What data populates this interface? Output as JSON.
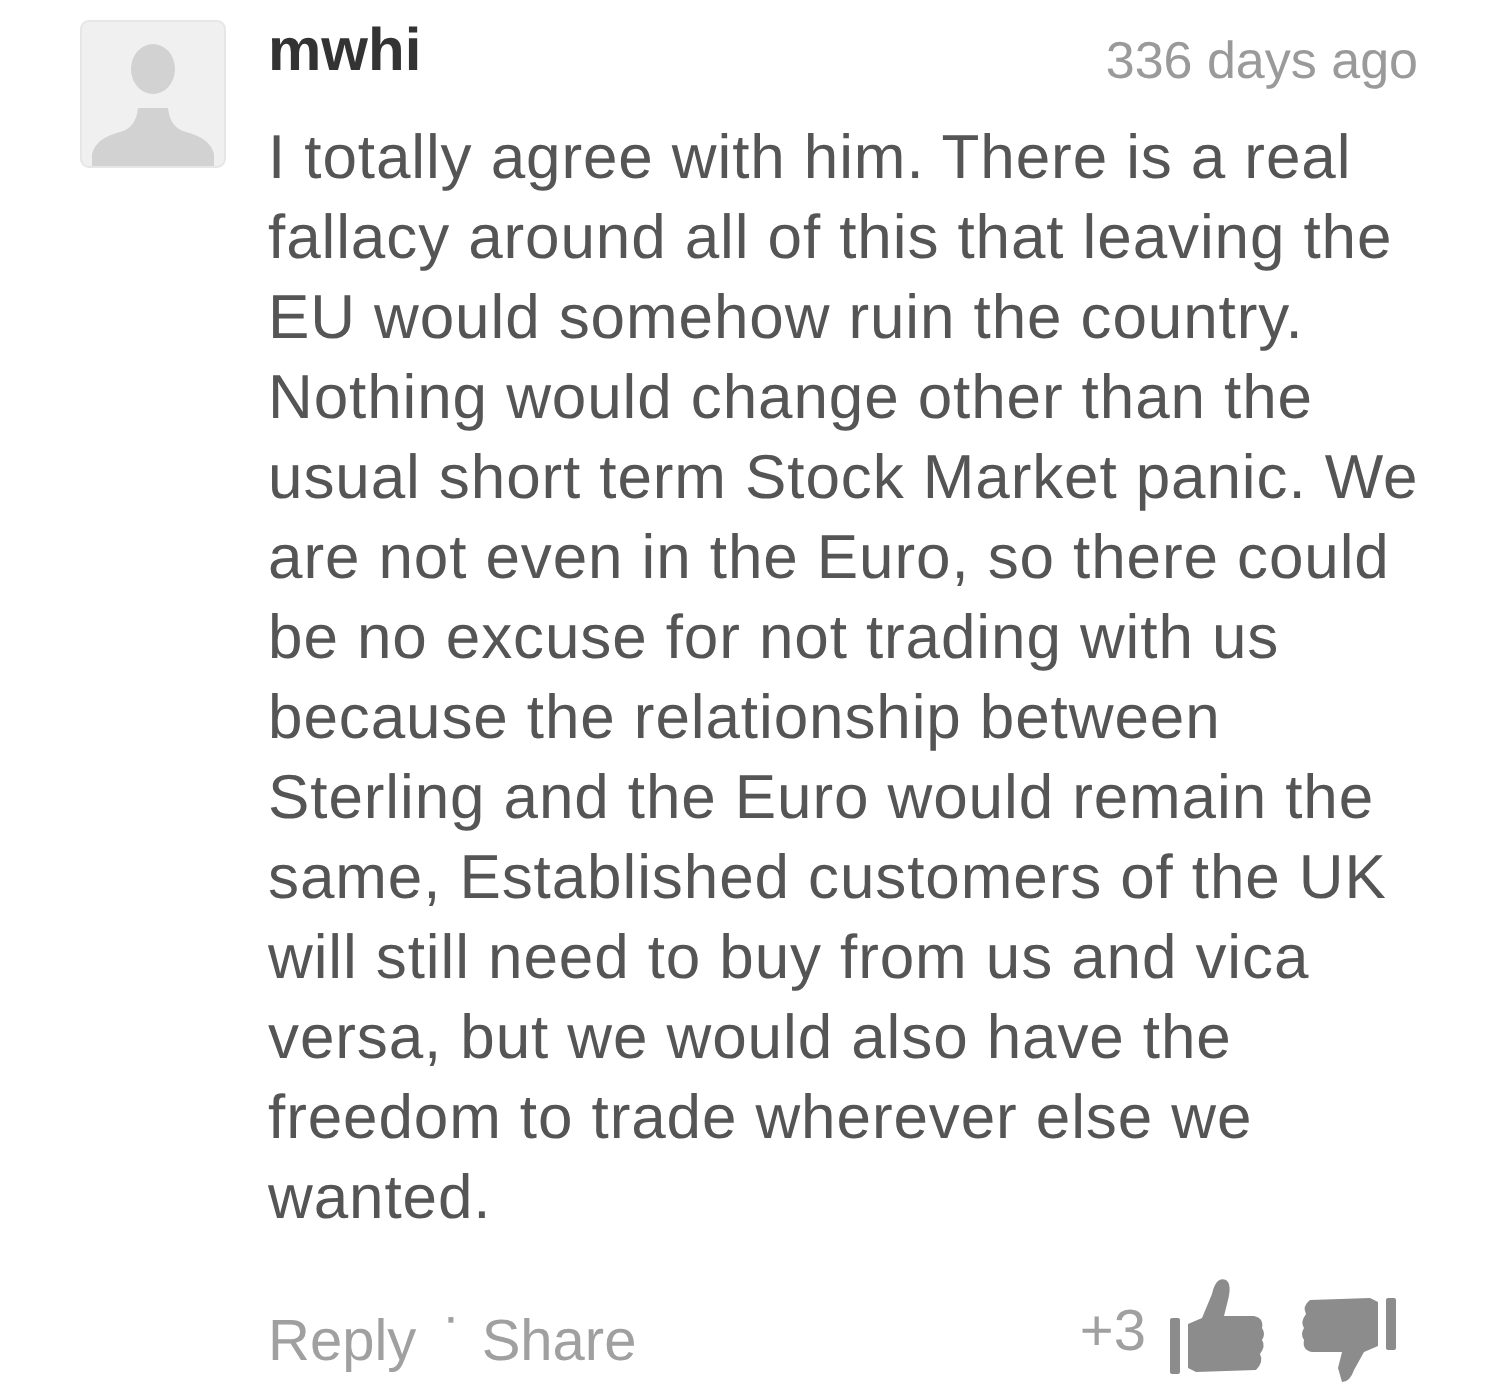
{
  "comment": {
    "author": "mwhi",
    "time": "336 days ago",
    "body": "I totally agree with him. There is a real fallacy around all of this that leaving the EU would somehow ruin the country. Nothing would change other than the usual short term Stock Market panic. We are not even in the Euro, so there could be no excuse for not trading with us because the relationship between Sterling and the Euro would remain the same, Established customers of the UK will still need to buy from us and vica versa, but we would also have the freedom to trade wherever else we wanted."
  },
  "actions": [
    {
      "label": "Reply"
    },
    {
      "label": "Share"
    }
  ],
  "separator": "·",
  "score": "+3"
}
